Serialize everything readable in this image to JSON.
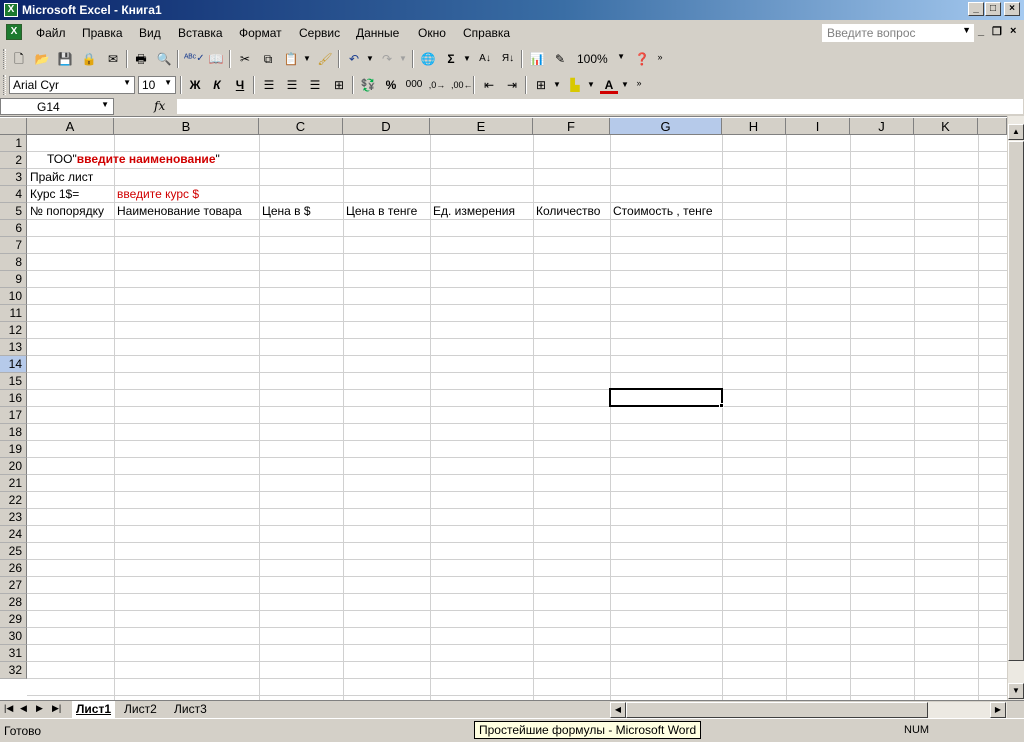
{
  "window": {
    "title": "Microsoft Excel - Книга1"
  },
  "menu": {
    "items": [
      "Файл",
      "Правка",
      "Вид",
      "Вставка",
      "Формат",
      "Сервис",
      "Данные",
      "Окно",
      "Справка"
    ],
    "help_placeholder": "Введите вопрос"
  },
  "toolbar": {
    "zoom": "100%",
    "font_name": "Arial Cyr",
    "font_size": "10",
    "bold": "Ж",
    "italic": "К",
    "underline": "Ч"
  },
  "formula_bar": {
    "name_box": "G14",
    "fx": "fx",
    "value": ""
  },
  "grid": {
    "columns": [
      "A",
      "B",
      "C",
      "D",
      "E",
      "F",
      "G",
      "H",
      "I",
      "J",
      "K"
    ],
    "selected_column": "G",
    "selected_row": "14",
    "rows": [
      "1",
      "2",
      "3",
      "4",
      "5",
      "6",
      "7",
      "8",
      "9",
      "10",
      "11",
      "12",
      "13",
      "14",
      "15",
      "16",
      "17",
      "18",
      "19",
      "20",
      "21",
      "22",
      "23",
      "24",
      "25",
      "26",
      "27",
      "28",
      "29",
      "30",
      "31",
      "32"
    ],
    "cells": {
      "A1_prefix": "ТОО\"",
      "A1_name": "введите наименование",
      "A1_suffix": "\"",
      "A2": "Прайс лист",
      "A3": "Курс 1$=",
      "B3": "введите курс $",
      "A4": "№ попорядку",
      "B4": "Наименование товара",
      "C4": "Цена в $",
      "D4": "Цена в тенге",
      "E4": "Ед. измерения",
      "F4": "Количество",
      "G4": "Стоимость , тенге"
    }
  },
  "sheets": [
    "Лист1",
    "Лист2",
    "Лист3"
  ],
  "active_sheet": "Лист1",
  "status": {
    "text": "Готово",
    "num": "NUM",
    "tooltip": "Простейшие формулы - Microsoft Word"
  }
}
